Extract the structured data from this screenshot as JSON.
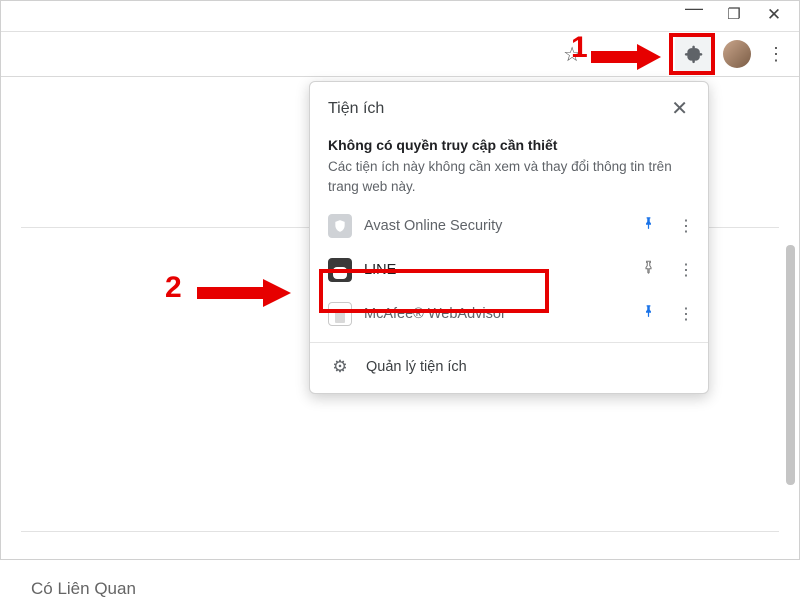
{
  "window_controls": {
    "minimize": "—",
    "maxres": "❐",
    "close": "✕"
  },
  "popup": {
    "title": "Tiện ích",
    "close": "✕",
    "perm_heading": "Không có quyền truy cập cần thiết",
    "perm_desc": "Các tiện ích này không cần xem và thay đổi thông tin trên trang web này.",
    "extensions": [
      {
        "label": "Avast Online Security",
        "pinned": true
      },
      {
        "label": "LINE",
        "pinned": false
      },
      {
        "label": "McAfee® WebAdvisor",
        "pinned": true
      }
    ],
    "manage_label": "Quản lý tiện ích"
  },
  "page": {
    "related_heading": "Có Liên Quan"
  },
  "annotations": {
    "one": "1",
    "two": "2"
  }
}
